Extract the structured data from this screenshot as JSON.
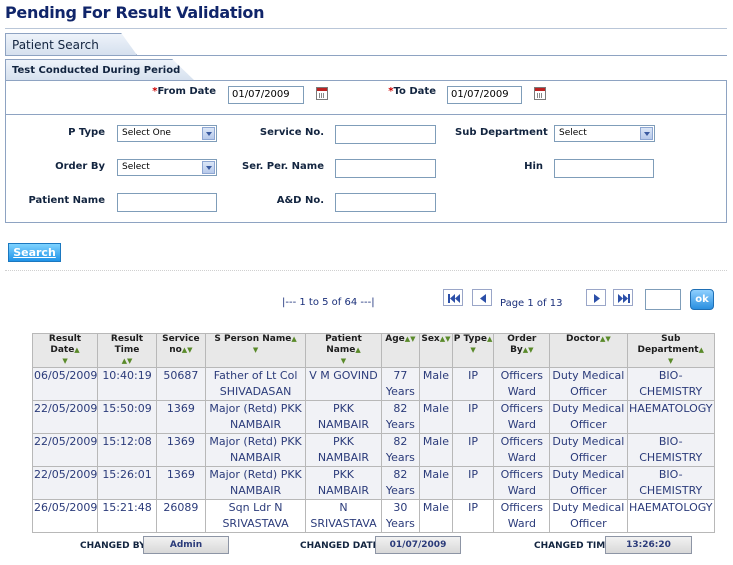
{
  "page_title": "Pending For Result Validation",
  "tabs": {
    "patient_search": "Patient Search",
    "test_period": "Test Conducted During Period"
  },
  "period": {
    "from_label": "From Date",
    "from_value": "01/07/2009",
    "to_label": "To Date",
    "to_value": "01/07/2009",
    "required_mark": "*"
  },
  "filters": {
    "ptype_label": "P Type",
    "ptype_value": "Select One",
    "service_no_label": "Service No.",
    "service_no_value": "",
    "sub_dept_label": "Sub Department",
    "sub_dept_value": "Select",
    "order_by_label": "Order By",
    "order_by_value": "Select",
    "ser_per_name_label": "Ser. Per. Name",
    "ser_per_name_value": "",
    "hin_label": "Hin",
    "hin_value": "",
    "patient_name_label": "Patient Name",
    "patient_name_value": "",
    "ad_no_label": "A&D No.",
    "ad_no_value": ""
  },
  "search_button": "Search",
  "pager": {
    "range_text": "|--- 1   to   5   of   64 ---|",
    "page_info": "Page 1 of 13",
    "go_value": "",
    "ok_label": "ok"
  },
  "table": {
    "headers": [
      "Result Date",
      "Result Time",
      "Service no",
      "S Person Name",
      "Patient Name",
      "Age",
      "Sex",
      "P Type",
      "Order By",
      "Doctor",
      "Sub Department"
    ],
    "rows": [
      [
        "06/05/2009",
        "10:40:19",
        "50687",
        "Father of Lt Col SHIVADASAN",
        "V M GOVIND",
        "77 Years",
        "Male",
        "IP",
        "Officers Ward",
        "Duty Medical Officer",
        "BIO-CHEMISTRY"
      ],
      [
        "22/05/2009",
        "15:50:09",
        "1369",
        "Major (Retd) PKK NAMBAIR",
        "PKK NAMBAIR",
        "82 Years",
        "Male",
        "IP",
        "Officers Ward",
        "Duty Medical Officer",
        "HAEMATOLOGY"
      ],
      [
        "22/05/2009",
        "15:12:08",
        "1369",
        "Major (Retd) PKK NAMBAIR",
        "PKK NAMBAIR",
        "82 Years",
        "Male",
        "IP",
        "Officers Ward",
        "Duty Medical Officer",
        "BIO-CHEMISTRY"
      ],
      [
        "22/05/2009",
        "15:26:01",
        "1369",
        "Major (Retd) PKK NAMBAIR",
        "PKK NAMBAIR",
        "82 Years",
        "Male",
        "IP",
        "Officers Ward",
        "Duty Medical Officer",
        "BIO-CHEMISTRY"
      ],
      [
        "26/05/2009",
        "15:21:48",
        "26089",
        "Sqn Ldr N SRIVASTAVA",
        "N SRIVASTAVA",
        "30 Years",
        "Male",
        "IP",
        "Officers Ward",
        "Duty Medical Officer",
        "HAEMATOLOGY"
      ]
    ]
  },
  "footer": {
    "changed_by_label": "CHANGED BY",
    "changed_by_value": "Admin",
    "changed_date_label": "CHANGED DATE",
    "changed_date_value": "01/07/2009",
    "changed_time_label": "CHANGED TIME",
    "changed_time_value": "13:26:20"
  },
  "colors": {
    "title": "#10256a",
    "accent_button": "#1f93e8",
    "required": "#cc0000"
  }
}
